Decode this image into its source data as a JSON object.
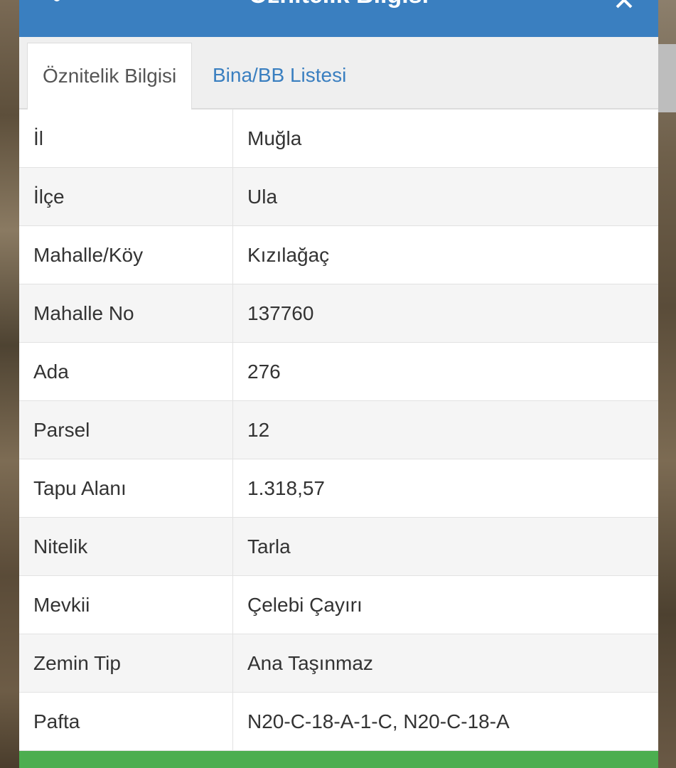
{
  "dialog": {
    "title": "Öznitelik Bilgisi"
  },
  "tabs": [
    {
      "label": "Öznitelik Bilgisi",
      "active": true
    },
    {
      "label": "Bina/BB Listesi",
      "active": false
    }
  ],
  "attributes": [
    {
      "key": "İl",
      "value": "Muğla"
    },
    {
      "key": "İlçe",
      "value": "Ula"
    },
    {
      "key": "Mahalle/Köy",
      "value": "Kızılağaç"
    },
    {
      "key": "Mahalle No",
      "value": "137760"
    },
    {
      "key": "Ada",
      "value": "276"
    },
    {
      "key": "Parsel",
      "value": "12"
    },
    {
      "key": "Tapu Alanı",
      "value": "1.318,57"
    },
    {
      "key": "Nitelik",
      "value": "Tarla"
    },
    {
      "key": "Mevkii",
      "value": "Çelebi Çayırı"
    },
    {
      "key": "Zemin Tip",
      "value": "Ana Taşınmaz"
    },
    {
      "key": "Pafta",
      "value": "N20-C-18-A-1-C, N20-C-18-A"
    }
  ],
  "colors": {
    "header": "#3a7fc0",
    "tab_link": "#3a7fc0",
    "footer_button": "#4cae50"
  },
  "icons": {
    "menu": "menu-dots-icon",
    "close": "close-icon"
  }
}
